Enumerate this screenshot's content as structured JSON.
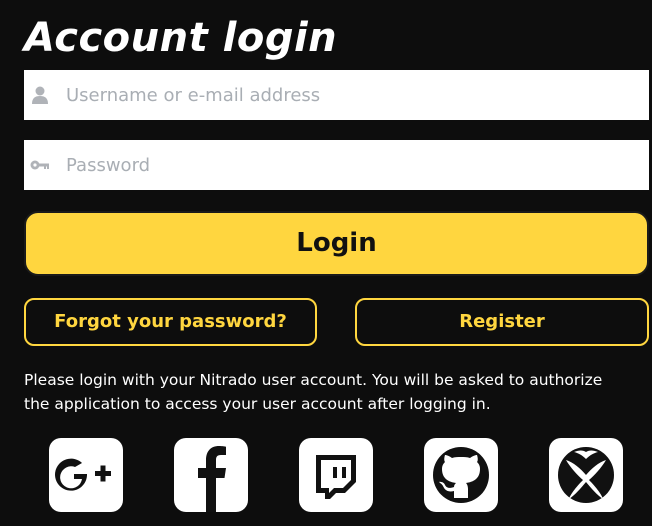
{
  "page": {
    "title": "Account login"
  },
  "form": {
    "username_placeholder": "Username or e-mail address",
    "password_placeholder": "Password",
    "username_icon": "user-icon",
    "password_icon": "key-icon"
  },
  "buttons": {
    "login": "Login",
    "forgot_password": "Forgot your password?",
    "register": "Register"
  },
  "info_text": "Please login with your Nitrado user account. You will be asked to authorize the application to access your user account after logging in.",
  "social_logins": [
    {
      "name": "Google+",
      "icon": "google-plus-icon"
    },
    {
      "name": "Facebook",
      "icon": "facebook-icon"
    },
    {
      "name": "Twitch",
      "icon": "twitch-icon"
    },
    {
      "name": "GitHub",
      "icon": "github-icon"
    },
    {
      "name": "Xbox",
      "icon": "xbox-icon"
    }
  ],
  "colors": {
    "background": "#0d0d0d",
    "accent": "#ffd63f",
    "text": "#ffffff",
    "placeholder": "#a9aeb4",
    "icon_grey": "#b0b3b8"
  }
}
